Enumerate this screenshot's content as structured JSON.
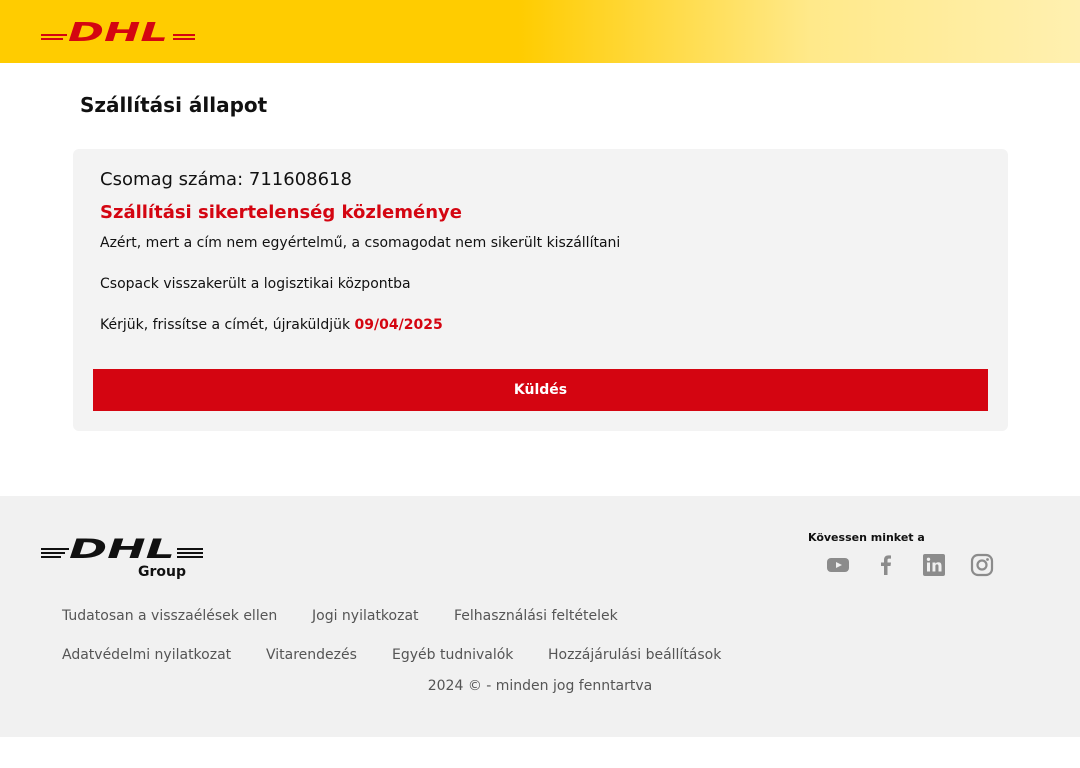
{
  "header": {
    "logo_text": "DHL"
  },
  "main": {
    "page_title": "Szállítási állapot",
    "package_label": "Csomag száma:",
    "package_number": "711608618",
    "notice_title": "Szállítási sikertelenség közleménye",
    "message_1": "Azért, mert a cím nem egyértelmű, a csomagodat nem sikerült kiszállítani",
    "message_2": "Csopack visszakerült a logisztikai központba",
    "message_3": "Kérjük, frissítse a címét, újraküldjük",
    "resend_date": "09/04/2025",
    "send_label": "Küldés"
  },
  "footer": {
    "logo_text": "DHL",
    "logo_sub": "Group",
    "follow_label": "Kövessen minket a",
    "social": [
      "youtube-icon",
      "facebook-icon",
      "linkedin-icon",
      "instagram-icon"
    ],
    "links_row1": [
      "Tudatosan a visszaélések ellen",
      "Jogi nyilatkozat",
      "Felhasználási feltételek"
    ],
    "links_row2": [
      "Adatvédelmi nyilatkozat",
      "Vitarendezés",
      "Egyéb tudnivalók",
      "Hozzájárulási beállítások"
    ],
    "copyright": "2024 © - minden jog fenntartva"
  },
  "colors": {
    "brand_yellow": "#ffcc00",
    "brand_red": "#d40511",
    "icon_gray": "#8c8c8c"
  }
}
